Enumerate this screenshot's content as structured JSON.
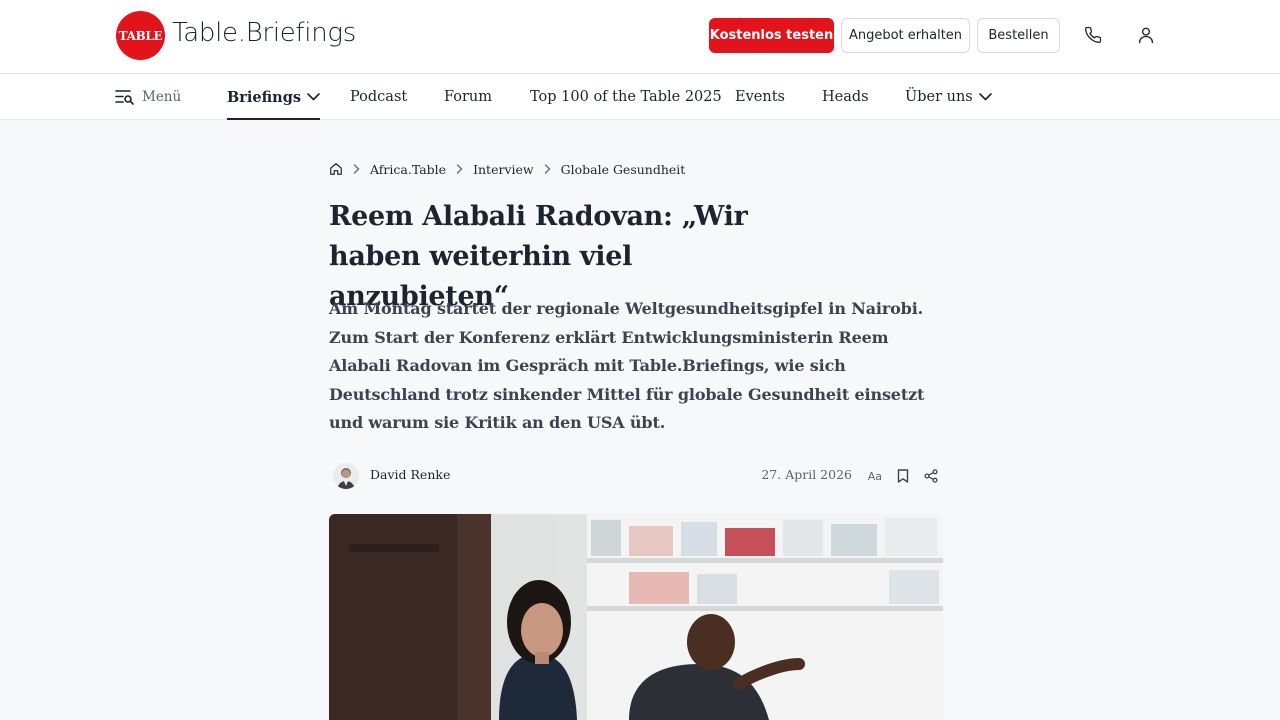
{
  "header": {
    "logo_badge": "TABLE",
    "logo_text": "Table.Briefings",
    "btn_trial": "Kostenlos testen",
    "btn_offer": "Angebot erhalten",
    "btn_order": "Bestellen",
    "icons": [
      "phone-icon",
      "user-icon"
    ],
    "accent_color": "#e3131b"
  },
  "nav": {
    "menu_label": "Menü",
    "items": [
      {
        "label": "Briefings",
        "active": true
      },
      {
        "label": "Podcast"
      },
      {
        "label": "Forum"
      },
      {
        "label": "Top 100 of the Table 2025"
      },
      {
        "label": "Events"
      },
      {
        "label": "Heads"
      },
      {
        "label": "Über uns"
      }
    ]
  },
  "breadcrumb": [
    "Africa.Table",
    "Interview",
    "Globale Gesundheit"
  ],
  "article": {
    "headline": "Reem Alabali Radovan: „Wir haben weiterhin viel anzubieten“",
    "lead": "Am Montag startet der regionale Weltgesundheitsgipfel in Nairobi. Zum Start der Konferenz erklärt Entwicklungsministerin Reem Alabali Radovan im Gespräch mit Table.Briefings, wie sich Deutschland trotz sinkender Mittel für globale Gesundheit einsetzt und warum sie Kritik an den USA übt.",
    "author": "David Renke",
    "date": "27. April 2026",
    "fontsize_label": "Aa"
  }
}
